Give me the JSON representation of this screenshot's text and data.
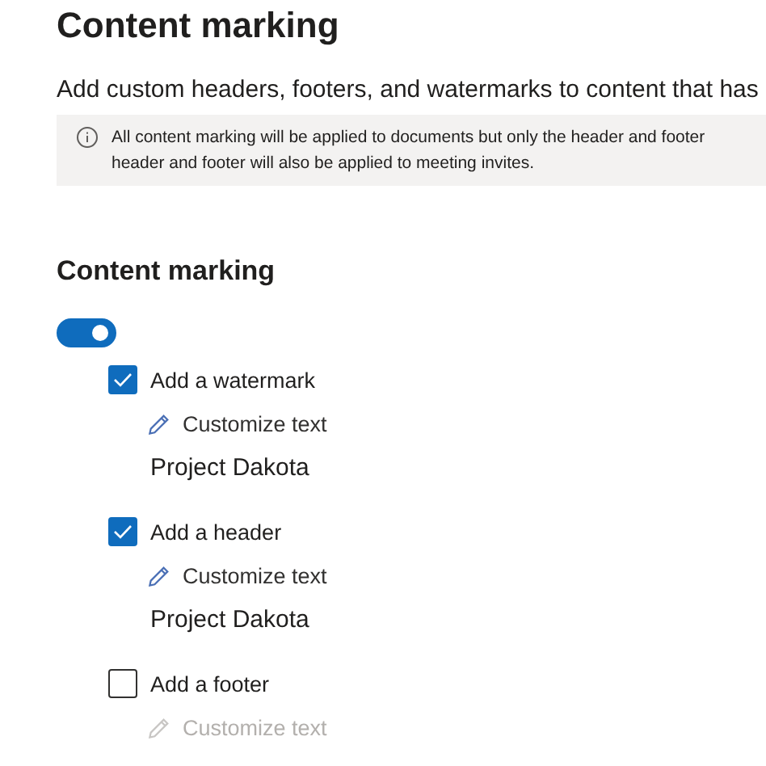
{
  "title": "Content marking",
  "description": "Add custom headers, footers, and watermarks to content that has",
  "info": {
    "text_lines": [
      "All content marking will be applied to documents but only the header and footer",
      "header and footer will also be applied to meeting invites."
    ]
  },
  "section": {
    "heading": "Content marking",
    "toggle": {
      "on": true
    }
  },
  "options": [
    {
      "label": "Add a watermark",
      "checked": true,
      "action": {
        "label": "Customize text",
        "disabled": false
      },
      "custom_text": "Project Dakota"
    },
    {
      "label": "Add a header",
      "checked": true,
      "action": {
        "label": "Customize text",
        "disabled": false
      },
      "custom_text": "Project Dakota"
    },
    {
      "label": "Add a footer",
      "checked": false,
      "action": {
        "label": "Customize text",
        "disabled": true
      }
    }
  ]
}
